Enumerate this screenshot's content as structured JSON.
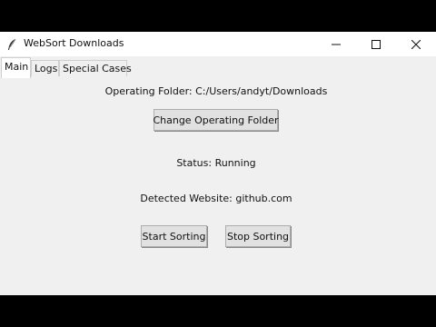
{
  "window": {
    "title": "WebSort Downloads"
  },
  "icons": {
    "app": "feather-icon",
    "minimize": "minimize-icon",
    "maximize": "maximize-icon",
    "close": "close-icon"
  },
  "tabs": [
    {
      "label": "Main",
      "active": true
    },
    {
      "label": "Logs",
      "active": false
    },
    {
      "label": "Special Cases",
      "active": false
    }
  ],
  "main": {
    "operating_folder": "Operating Folder: C:/Users/andyt/Downloads",
    "change_folder_label": "Change Operating Folder",
    "status": "Status: Running",
    "detected_website": "Detected Website: github.com",
    "start_label": "Start Sorting",
    "stop_label": "Stop Sorting"
  }
}
